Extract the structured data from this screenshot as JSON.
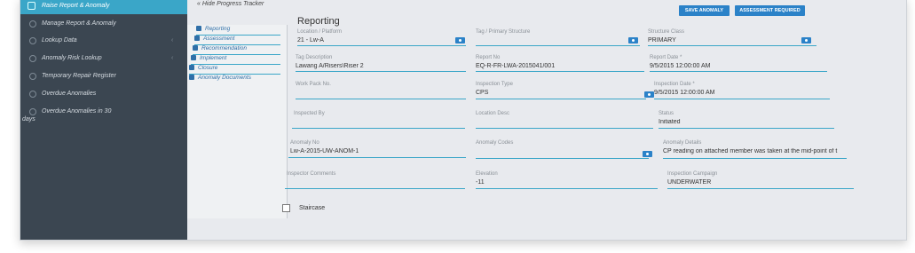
{
  "sidebar": {
    "top_item": "Raise Report & Anomaly",
    "items": [
      {
        "label": "Manage Report & Anomaly",
        "chevron": ""
      },
      {
        "label": "Lookup Data",
        "chevron": "‹"
      },
      {
        "label": "Anomaly Risk Lookup",
        "chevron": "‹"
      },
      {
        "label": "Temporary Repair Register",
        "chevron": ""
      },
      {
        "label": "Overdue Anomalies",
        "chevron": ""
      },
      {
        "label": "Overdue Anomalies in 30",
        "label2": "days",
        "chevron": ""
      }
    ]
  },
  "tracker": {
    "toggle": "« Hide Progress Tracker",
    "items": [
      "Reporting",
      "Assessment",
      "Recommendation",
      "Implement",
      "Closure",
      "Anomaly Documents"
    ]
  },
  "header": {
    "save_label": "SAVE ANOMALY",
    "assessment_label": "ASSESSMENT REQUIRED"
  },
  "page_title": "Reporting",
  "fields": {
    "location": {
      "label": "Location / Platform",
      "value": "21 - Lw-A"
    },
    "tag_primary": {
      "label": "Tag / Primary Structure",
      "value": ""
    },
    "structure_class": {
      "label": "Structure Class",
      "value": "PRIMARY"
    },
    "tag_description": {
      "label": "Tag Description",
      "value": "Lawang A/Risers\\Riser 2"
    },
    "report_no": {
      "label": "Report No",
      "value": "EQ-R-FR-LWA-2015041/001"
    },
    "report_date": {
      "label": "Report Date *",
      "value": "9/5/2015 12:00:00 AM"
    },
    "work_pack_no": {
      "label": "Work Pack No.",
      "value": ""
    },
    "inspection_type": {
      "label": "Inspection Type",
      "value": "CPS"
    },
    "inspection_date": {
      "label": "Inspection Date *",
      "value": "9/5/2015 12:00:00 AM"
    },
    "inspected_by": {
      "label": "Inspected By",
      "value": ""
    },
    "location_desc": {
      "label": "Location Desc",
      "value": ""
    },
    "status": {
      "label": "Status",
      "value": "Initiated"
    },
    "anomaly_no": {
      "label": "Anomaly No",
      "value": "Lw-A-2015-UW-ANOM-1"
    },
    "anomaly_codes": {
      "label": "Anomaly Codes",
      "value": ""
    },
    "anomaly_details": {
      "label": "Anomaly Details",
      "value": "CP reading on attached member was taken at the mid-point of t"
    },
    "inspector_comments": {
      "label": "Inspector Comments",
      "value": ""
    },
    "elevation": {
      "label": "Elevation",
      "value": "-11"
    },
    "inspection_campaign": {
      "label": "Inspection Campaign",
      "value": "UNDERWATER"
    }
  },
  "staircase_label": "Staircase",
  "colors": {
    "accent": "#3aa6c8",
    "button": "#2b82c8",
    "sidebar": "#3b4651"
  }
}
